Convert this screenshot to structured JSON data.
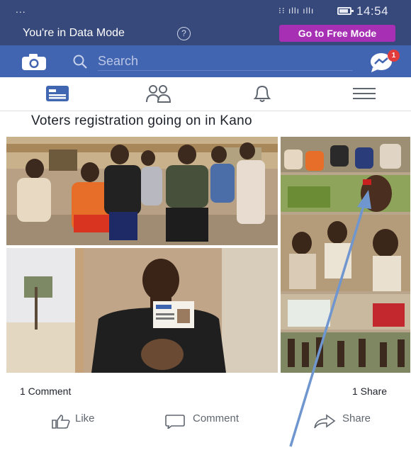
{
  "status_bar": {
    "dots": "...",
    "signal": "⁝⁝ ıllı ıllı",
    "time": "14:54"
  },
  "data_mode": {
    "text": "You're in Data Mode",
    "help": "?",
    "button": "Go to Free Mode"
  },
  "search": {
    "placeholder": "Search",
    "messenger_badge": "1"
  },
  "nav": {
    "tabs": [
      "news-feed",
      "friends",
      "notifications",
      "menu"
    ],
    "active": "news-feed"
  },
  "post": {
    "title": "Voters registration going on in Kano",
    "comments": "1 Comment",
    "shares": "1 Share",
    "actions": {
      "like": "Like",
      "comment": "Comment",
      "share": "Share"
    }
  },
  "colors": {
    "header": "#37497a",
    "fb_blue": "#4265b2",
    "free_mode": "#a62fb4",
    "arrow": "#6f96cf"
  }
}
